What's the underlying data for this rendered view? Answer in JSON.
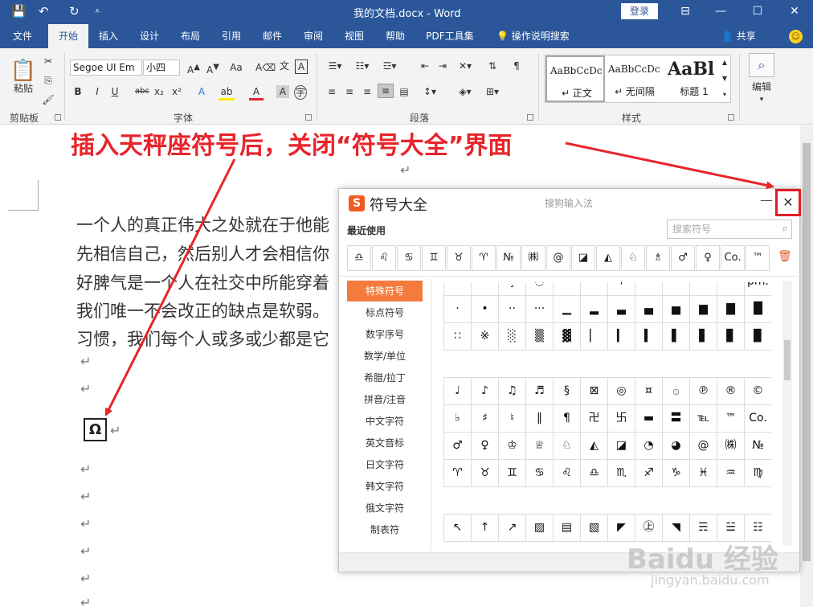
{
  "titlebar": {
    "title": "我的文档.docx  -  Word",
    "login": "登录",
    "save_glyph": "💾",
    "undo_glyph": "↶",
    "redo_glyph": "↻",
    "customize_glyph": "⩡",
    "ribbon_display_glyph": "⊟",
    "minimize_glyph": "—",
    "maximize_glyph": "☐",
    "close_glyph": "✕"
  },
  "tabs": [
    "文件",
    "开始",
    "插入",
    "设计",
    "布局",
    "引用",
    "邮件",
    "审阅",
    "视图",
    "帮助",
    "PDF工具集"
  ],
  "active_tab": "开始",
  "tell_me": "操作说明搜索",
  "share": "共享",
  "ribbon": {
    "paste": "粘贴",
    "font_name": "Segoe UI Em",
    "font_size": "小四",
    "groups": {
      "clipboard": "剪贴板",
      "font": "字体",
      "paragraph": "段落",
      "styles": "样式",
      "editing": "编辑"
    },
    "font_buttons": [
      "B",
      "I",
      "U",
      "abc",
      "x₂",
      "x²"
    ],
    "styles": [
      {
        "preview": "AaBbCcDc",
        "name": "↵ 正文"
      },
      {
        "preview": "AaBbCcDc",
        "name": "↵ 无间隔"
      },
      {
        "preview": "AaBl",
        "name": "标题 1"
      }
    ]
  },
  "document": {
    "lines": [
      "一个人的真正伟大之处就在于他能",
      "先相信自己，然后别人才会相信你",
      "好脾气是一个人在社交中所能穿着",
      "我们唯一不会改正的缺点是软弱。",
      "习惯，我们每个人或多或少都是它"
    ],
    "para_mark": "↵",
    "inserted_symbol": "Ω"
  },
  "annotation": "插入天秤座符号后，关闭“符号大全”界面",
  "dialog": {
    "title": "符号大全",
    "subtitle": "搜狗输入法",
    "min": "—",
    "close": "✕",
    "recent_label": "最近使用",
    "search_placeholder": "搜索符号",
    "recent": [
      "♎",
      "♌",
      "♋",
      "♊",
      "♉",
      "♈",
      "№",
      "㈱",
      "@",
      "◪",
      "◭",
      "♘",
      "♗",
      "♂",
      "♀",
      "Co.",
      "™"
    ],
    "categories": [
      "特殊符号",
      "标点符号",
      "数字序号",
      "数学/单位",
      "希腊/拉丁",
      "拼音/注音",
      "中文字符",
      "英文音标",
      "日文字符",
      "韩文字符",
      "俄文字符",
      "制表符"
    ],
    "active_category": "特殊符号",
    "grid_partial": [
      "·",
      "˙",
      "¸",
      "◌",
      "ˊ",
      "－",
      "＋",
      "ˋ",
      "‐",
      "－",
      "ˇ",
      "pm."
    ],
    "grid_block1": [
      "·",
      "•",
      "··",
      "···",
      "▁",
      "▂",
      "▃",
      "▄",
      "▅",
      "▆",
      "▇",
      "█",
      "∷",
      "※",
      "░",
      "▒",
      "▓",
      "▏",
      "▎",
      "▍",
      "▌",
      "▋",
      "▊",
      "▉"
    ],
    "grid_block2": [
      "♩",
      "♪",
      "♫",
      "♬",
      "§",
      "⊠",
      "◎",
      "¤",
      "۞",
      "℗",
      "®",
      "©",
      "♭",
      "♯",
      "♮",
      "‖",
      "¶",
      "卍",
      "卐",
      "▬",
      "〓",
      "℡",
      "™",
      "Co.",
      "♂",
      "♀",
      "♔",
      "♕",
      "♘",
      "◭",
      "◪",
      "◔",
      "◕",
      "@",
      "㈱",
      "№",
      "♈",
      "♉",
      "♊",
      "♋",
      "♌",
      "♎",
      "♏",
      "♐",
      "♑",
      "♓",
      "♒",
      "♍"
    ],
    "grid_block3": [
      "↖",
      "↑",
      "↗",
      "▨",
      "▤",
      "▧",
      "◤",
      "㊤",
      "◥",
      "☴",
      "☱",
      "☷"
    ]
  },
  "watermark": "Baidu 经验",
  "watermark_sub": "jingyan.baidu.com",
  "colors": {
    "word_blue": "#2b579a",
    "accent_orange": "#f47b3d",
    "annotation_red": "#e8242b"
  }
}
